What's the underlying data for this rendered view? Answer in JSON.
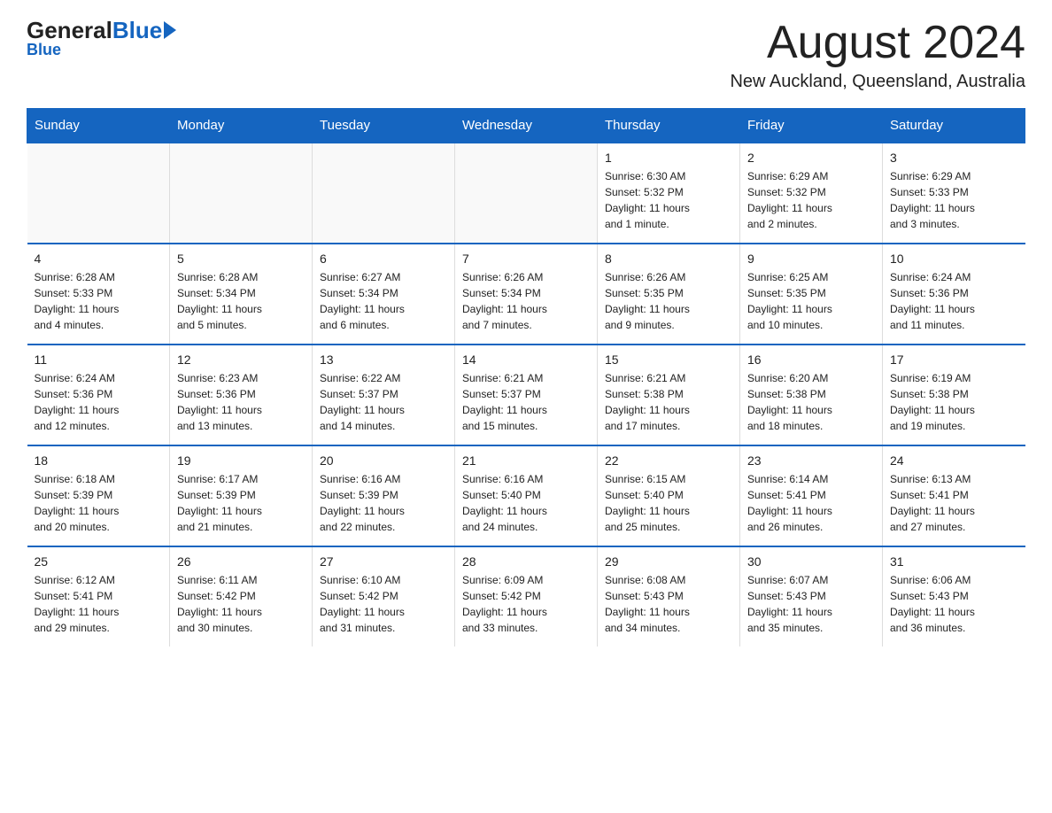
{
  "logo": {
    "general": "General",
    "blue": "Blue",
    "arrow_symbol": "▶"
  },
  "header": {
    "title": "August 2024",
    "subtitle": "New Auckland, Queensland, Australia"
  },
  "weekdays": [
    "Sunday",
    "Monday",
    "Tuesday",
    "Wednesday",
    "Thursday",
    "Friday",
    "Saturday"
  ],
  "weeks": [
    {
      "days": [
        {
          "num": "",
          "info": "",
          "empty": true
        },
        {
          "num": "",
          "info": "",
          "empty": true
        },
        {
          "num": "",
          "info": "",
          "empty": true
        },
        {
          "num": "",
          "info": "",
          "empty": true
        },
        {
          "num": "1",
          "info": "Sunrise: 6:30 AM\nSunset: 5:32 PM\nDaylight: 11 hours\nand 1 minute.",
          "empty": false
        },
        {
          "num": "2",
          "info": "Sunrise: 6:29 AM\nSunset: 5:32 PM\nDaylight: 11 hours\nand 2 minutes.",
          "empty": false
        },
        {
          "num": "3",
          "info": "Sunrise: 6:29 AM\nSunset: 5:33 PM\nDaylight: 11 hours\nand 3 minutes.",
          "empty": false
        }
      ]
    },
    {
      "days": [
        {
          "num": "4",
          "info": "Sunrise: 6:28 AM\nSunset: 5:33 PM\nDaylight: 11 hours\nand 4 minutes.",
          "empty": false
        },
        {
          "num": "5",
          "info": "Sunrise: 6:28 AM\nSunset: 5:34 PM\nDaylight: 11 hours\nand 5 minutes.",
          "empty": false
        },
        {
          "num": "6",
          "info": "Sunrise: 6:27 AM\nSunset: 5:34 PM\nDaylight: 11 hours\nand 6 minutes.",
          "empty": false
        },
        {
          "num": "7",
          "info": "Sunrise: 6:26 AM\nSunset: 5:34 PM\nDaylight: 11 hours\nand 7 minutes.",
          "empty": false
        },
        {
          "num": "8",
          "info": "Sunrise: 6:26 AM\nSunset: 5:35 PM\nDaylight: 11 hours\nand 9 minutes.",
          "empty": false
        },
        {
          "num": "9",
          "info": "Sunrise: 6:25 AM\nSunset: 5:35 PM\nDaylight: 11 hours\nand 10 minutes.",
          "empty": false
        },
        {
          "num": "10",
          "info": "Sunrise: 6:24 AM\nSunset: 5:36 PM\nDaylight: 11 hours\nand 11 minutes.",
          "empty": false
        }
      ]
    },
    {
      "days": [
        {
          "num": "11",
          "info": "Sunrise: 6:24 AM\nSunset: 5:36 PM\nDaylight: 11 hours\nand 12 minutes.",
          "empty": false
        },
        {
          "num": "12",
          "info": "Sunrise: 6:23 AM\nSunset: 5:36 PM\nDaylight: 11 hours\nand 13 minutes.",
          "empty": false
        },
        {
          "num": "13",
          "info": "Sunrise: 6:22 AM\nSunset: 5:37 PM\nDaylight: 11 hours\nand 14 minutes.",
          "empty": false
        },
        {
          "num": "14",
          "info": "Sunrise: 6:21 AM\nSunset: 5:37 PM\nDaylight: 11 hours\nand 15 minutes.",
          "empty": false
        },
        {
          "num": "15",
          "info": "Sunrise: 6:21 AM\nSunset: 5:38 PM\nDaylight: 11 hours\nand 17 minutes.",
          "empty": false
        },
        {
          "num": "16",
          "info": "Sunrise: 6:20 AM\nSunset: 5:38 PM\nDaylight: 11 hours\nand 18 minutes.",
          "empty": false
        },
        {
          "num": "17",
          "info": "Sunrise: 6:19 AM\nSunset: 5:38 PM\nDaylight: 11 hours\nand 19 minutes.",
          "empty": false
        }
      ]
    },
    {
      "days": [
        {
          "num": "18",
          "info": "Sunrise: 6:18 AM\nSunset: 5:39 PM\nDaylight: 11 hours\nand 20 minutes.",
          "empty": false
        },
        {
          "num": "19",
          "info": "Sunrise: 6:17 AM\nSunset: 5:39 PM\nDaylight: 11 hours\nand 21 minutes.",
          "empty": false
        },
        {
          "num": "20",
          "info": "Sunrise: 6:16 AM\nSunset: 5:39 PM\nDaylight: 11 hours\nand 22 minutes.",
          "empty": false
        },
        {
          "num": "21",
          "info": "Sunrise: 6:16 AM\nSunset: 5:40 PM\nDaylight: 11 hours\nand 24 minutes.",
          "empty": false
        },
        {
          "num": "22",
          "info": "Sunrise: 6:15 AM\nSunset: 5:40 PM\nDaylight: 11 hours\nand 25 minutes.",
          "empty": false
        },
        {
          "num": "23",
          "info": "Sunrise: 6:14 AM\nSunset: 5:41 PM\nDaylight: 11 hours\nand 26 minutes.",
          "empty": false
        },
        {
          "num": "24",
          "info": "Sunrise: 6:13 AM\nSunset: 5:41 PM\nDaylight: 11 hours\nand 27 minutes.",
          "empty": false
        }
      ]
    },
    {
      "days": [
        {
          "num": "25",
          "info": "Sunrise: 6:12 AM\nSunset: 5:41 PM\nDaylight: 11 hours\nand 29 minutes.",
          "empty": false
        },
        {
          "num": "26",
          "info": "Sunrise: 6:11 AM\nSunset: 5:42 PM\nDaylight: 11 hours\nand 30 minutes.",
          "empty": false
        },
        {
          "num": "27",
          "info": "Sunrise: 6:10 AM\nSunset: 5:42 PM\nDaylight: 11 hours\nand 31 minutes.",
          "empty": false
        },
        {
          "num": "28",
          "info": "Sunrise: 6:09 AM\nSunset: 5:42 PM\nDaylight: 11 hours\nand 33 minutes.",
          "empty": false
        },
        {
          "num": "29",
          "info": "Sunrise: 6:08 AM\nSunset: 5:43 PM\nDaylight: 11 hours\nand 34 minutes.",
          "empty": false
        },
        {
          "num": "30",
          "info": "Sunrise: 6:07 AM\nSunset: 5:43 PM\nDaylight: 11 hours\nand 35 minutes.",
          "empty": false
        },
        {
          "num": "31",
          "info": "Sunrise: 6:06 AM\nSunset: 5:43 PM\nDaylight: 11 hours\nand 36 minutes.",
          "empty": false
        }
      ]
    }
  ]
}
